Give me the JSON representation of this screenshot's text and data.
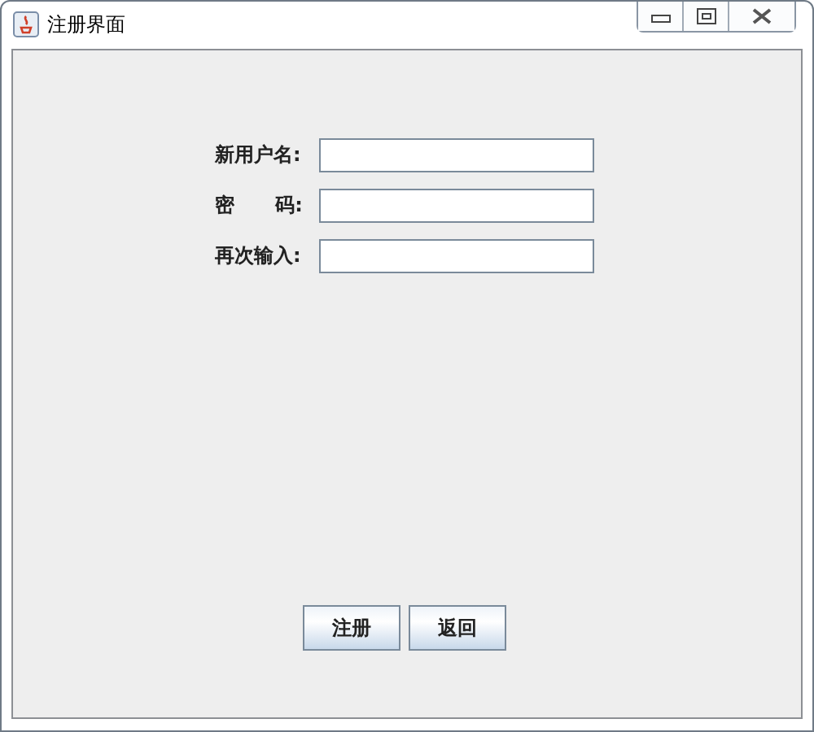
{
  "window": {
    "title": "注册界面"
  },
  "form": {
    "fields": [
      {
        "label": "新用户名:"
      },
      {
        "label": "密      码:"
      },
      {
        "label": "再次输入:"
      }
    ]
  },
  "buttons": [
    "注册",
    "返回"
  ]
}
